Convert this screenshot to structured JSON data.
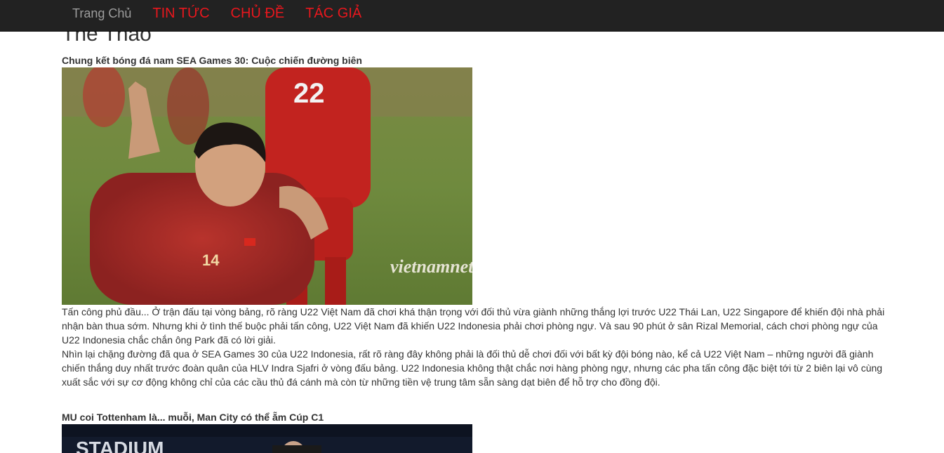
{
  "nav": {
    "items": [
      {
        "label": "Trang Chủ"
      },
      {
        "label": "TIN TỨC"
      },
      {
        "label": "CHỦ ĐỀ"
      },
      {
        "label": "TÁC GIẢ"
      }
    ]
  },
  "section": {
    "title": "Thể Thao"
  },
  "articles": [
    {
      "title": "Chung kết bóng đá nam SEA Games 30: Cuộc chiến đường biên",
      "image_watermark": "vietnamnet",
      "paragraphs": [
        "Tấn công phủ đầu... Ở trận đấu tại vòng bảng, rõ ràng U22 Việt Nam đã chơi khá thận trọng với đối thủ vừa giành những thắng lợi trước U22 Thái Lan, U22 Singapore để khiến đội nhà phải nhận bàn thua sớm. Nhưng khi ở tình thế buộc phải tấn công, U22 Việt Nam đã khiến U22 Indonesia phải chơi phòng ngự. Và sau 90 phút ở sân Rizal Memorial, cách chơi phòng ngự của U22 Indonesia chắc chắn ông Park đã có lời giải.",
        "Nhìn lại chặng đường đã qua ở SEA Games 30 của U22 Indonesia, rất rõ ràng đây không phải là đối thủ dễ chơi đối với bất kỳ đội bóng nào, kể cả U22 Việt Nam – những người đã giành chiến thắng duy nhất trước đoàn quân của HLV Indra Sjafri ở vòng đấu bảng. U22 Indonesia không thật chắc nơi hàng phòng ngự, nhưng các pha tấn công đặc biệt tới từ 2 biên lại vô cùng xuất sắc với sự cơ động không chỉ của các cầu thủ đá cánh mà còn từ những tiền vệ trung tâm sẵn sàng dạt biên để hỗ trợ cho đồng đội."
      ]
    },
    {
      "title": "MU coi Tottenham là... muỗi, Man City có thể ẵm Cúp C1",
      "image_text": "STADIUM"
    }
  ]
}
